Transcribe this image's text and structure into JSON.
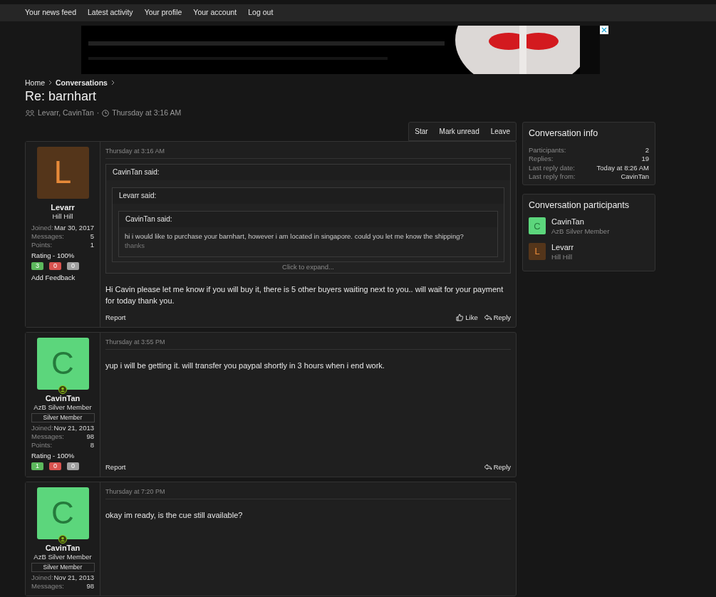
{
  "nav": [
    {
      "label": "Your news feed"
    },
    {
      "label": "Latest activity"
    },
    {
      "label": "Your profile"
    },
    {
      "label": "Your account"
    },
    {
      "label": "Log out"
    }
  ],
  "breadcrumbs": [
    {
      "label": "Home",
      "bold": false
    },
    {
      "label": "Conversations",
      "bold": true
    }
  ],
  "title": "Re: barnhart",
  "meta": {
    "participants": "Levarr, CavinTan",
    "separator": "·",
    "date": "Thursday at 3:16 AM"
  },
  "actions": [
    {
      "label": "Star"
    },
    {
      "label": "Mark unread"
    },
    {
      "label": "Leave"
    }
  ],
  "posts": [
    {
      "avatar_letter": "L",
      "color": "#54351a",
      "online": false,
      "name": "Levarr",
      "title": "Hill Hill",
      "stats": [
        {
          "label": "Joined:",
          "value": "Mar 30, 2017"
        },
        {
          "label": "Messages:",
          "value": "5"
        },
        {
          "label": "Points:",
          "value": "1"
        }
      ],
      "rating": "Rating - 100%",
      "feedback": [
        {
          "count": "3",
          "color": "#5cb85c"
        },
        {
          "count": "0",
          "color": "#d9534f"
        },
        {
          "count": "0",
          "color": "#a0a0a0"
        }
      ],
      "add_feedback": "Add Feedback",
      "date": "Thursday at 3:16 AM",
      "quote": {
        "author": "CavinTan said:",
        "expand": "Click to expand...",
        "quote": {
          "author": "Levarr said:",
          "quote": {
            "author": "CavinTan said:",
            "text": "hi i would like to purchase your barnhart, however i am located in singapore. could you let me know the shipping?",
            "faded": "thanks"
          }
        }
      },
      "body": "Hi Cavin please let me know if you will buy it, there is 5 other buyers waiting next to you.. will wait for your payment for today thank you.",
      "report": "Report",
      "like": "Like",
      "reply": "Reply"
    },
    {
      "avatar_letter": "C",
      "color": "#5cd67c",
      "online": true,
      "name": "CavinTan",
      "title": "AzB Silver Member",
      "banner": "Silver Member",
      "stats": [
        {
          "label": "Joined:",
          "value": "Nov 21, 2013"
        },
        {
          "label": "Messages:",
          "value": "98"
        },
        {
          "label": "Points:",
          "value": "8"
        }
      ],
      "rating": "Rating - 100%",
      "feedback": [
        {
          "count": "1",
          "color": "#5cb85c"
        },
        {
          "count": "0",
          "color": "#d9534f"
        },
        {
          "count": "0",
          "color": "#a0a0a0"
        }
      ],
      "date": "Thursday at 3:55 PM",
      "body": "yup i will be getting it. will transfer you paypal shortly in 3 hours when i end work.",
      "report": "Report",
      "reply": "Reply"
    },
    {
      "avatar_letter": "C",
      "color": "#5cd67c",
      "online": true,
      "name": "CavinTan",
      "title": "AzB Silver Member",
      "banner": "Silver Member",
      "stats": [
        {
          "label": "Joined:",
          "value": "Nov 21, 2013"
        },
        {
          "label": "Messages:",
          "value": "98"
        }
      ],
      "date": "Thursday at 7:20 PM",
      "body": "okay im ready, is the cue still available?"
    }
  ],
  "info": {
    "title": "Conversation info",
    "rows": [
      {
        "label": "Participants:",
        "value": "2"
      },
      {
        "label": "Replies:",
        "value": "19"
      },
      {
        "label": "Last reply date:",
        "value": "Today at 8:26 AM"
      },
      {
        "label": "Last reply from:",
        "value": "CavinTan"
      }
    ]
  },
  "participants": {
    "title": "Conversation participants",
    "items": [
      {
        "letter": "C",
        "color": "#5cd67c",
        "name": "CavinTan",
        "title": "AzB Silver Member"
      },
      {
        "letter": "L",
        "color": "#54351a",
        "name": "Levarr",
        "title": "Hill Hill"
      }
    ]
  }
}
